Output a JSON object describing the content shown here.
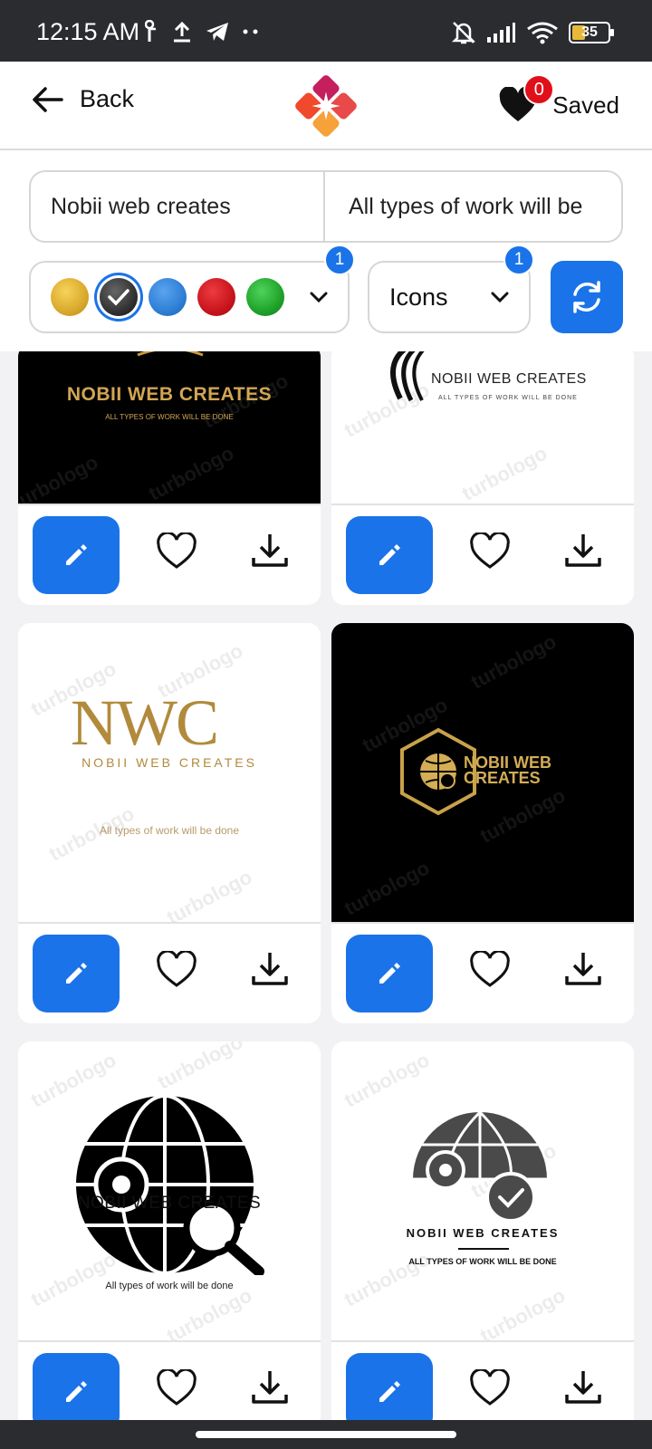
{
  "status_bar": {
    "time": "12:15 AM",
    "battery": "35"
  },
  "header": {
    "back_label": "Back",
    "saved_label": "Saved",
    "saved_count": "0"
  },
  "filters": {
    "company_name": "Nobii web creates",
    "slogan": "All types of work will be",
    "colors": [
      {
        "name": "gold",
        "color": "#d9a92c",
        "selected": false
      },
      {
        "name": "black",
        "color": "#333333",
        "selected": true
      },
      {
        "name": "blue",
        "color": "#2f7fd6",
        "selected": false
      },
      {
        "name": "red",
        "color": "#c8141c",
        "selected": false
      },
      {
        "name": "green",
        "color": "#1fa22a",
        "selected": false
      }
    ],
    "colors_badge": "1",
    "icons_label": "Icons",
    "icons_badge": "1"
  },
  "logos": [
    {
      "brand": "NOBII WEB CREATES",
      "tagline": "ALL TYPES OF WORK WILL BE DONE"
    },
    {
      "brand": "NOBII WEB CREATES",
      "tagline": "ALL TYPES OF WORK WILL BE DONE"
    },
    {
      "monogram": "NWC",
      "brand": "NOBII WEB CREATES",
      "tagline": "All types of work will be done"
    },
    {
      "brand_line1": "NOBII WEB",
      "brand_line2": "CREATES"
    },
    {
      "brand": "NOBII WEB CREATES",
      "tagline": "All types of work will be done"
    },
    {
      "brand": "NOBII WEB CREATES",
      "tagline": "ALL TYPES OF WORK WILL BE DONE"
    }
  ],
  "watermark": "turbologo",
  "accent_color": "#1a73e8"
}
